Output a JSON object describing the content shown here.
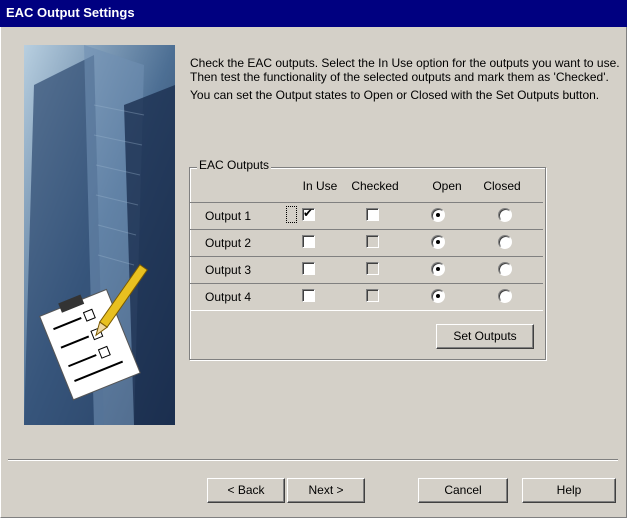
{
  "window": {
    "title": "EAC Output Settings"
  },
  "instructions": {
    "para1": "Check the EAC outputs. Select the In Use option for the outputs you want to use. Then test the functionality of the selected outputs and mark them as 'Checked'.",
    "para2": "You can set the Output states to Open or Closed with the Set Outputs button."
  },
  "group": {
    "label": "EAC Outputs",
    "columns": {
      "in_use": "In Use",
      "checked": "Checked",
      "open": "Open",
      "closed": "Closed"
    },
    "rows": [
      {
        "label": "Output 1",
        "in_use": true,
        "checked": false,
        "checked_enabled": true,
        "state": "open"
      },
      {
        "label": "Output 2",
        "in_use": false,
        "checked": false,
        "checked_enabled": false,
        "state": "open"
      },
      {
        "label": "Output 3",
        "in_use": false,
        "checked": false,
        "checked_enabled": false,
        "state": "open"
      },
      {
        "label": "Output 4",
        "in_use": false,
        "checked": false,
        "checked_enabled": false,
        "state": "open"
      }
    ],
    "set_outputs_label": "Set Outputs"
  },
  "buttons": {
    "back": "< Back",
    "next": "Next >",
    "cancel": "Cancel",
    "help": "Help"
  },
  "icons": {
    "side_image": "clipboard-checklist-pencil-icon",
    "check": "checkmark-icon"
  },
  "colors": {
    "title_bg": "#000080",
    "face": "#d4d0c8"
  }
}
